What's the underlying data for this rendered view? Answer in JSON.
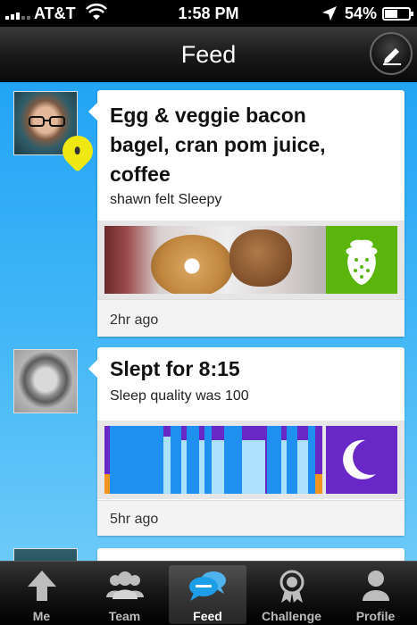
{
  "status_bar": {
    "carrier": "AT&T",
    "time": "1:58 PM",
    "battery": "54%",
    "battery_level": 0.54
  },
  "nav": {
    "title": "Feed",
    "compose_icon": "pencil-icon"
  },
  "feed": {
    "items": [
      {
        "title_lines": [
          "Egg & veggie bacon",
          "bagel, cran pom juice,",
          "coffee"
        ],
        "subtitle": "shawn felt Sleepy",
        "mood": "sleepy-face-icon",
        "category_icon": "strawberry-icon",
        "category_color": "#5ab50d",
        "time_ago": "2hr ago"
      },
      {
        "title_lines": [
          "Slept for 8:15"
        ],
        "subtitle": "Sleep quality was 100",
        "category_icon": "moon-icon",
        "category_color": "#6a27c8",
        "time_ago": "5hr ago"
      }
    ]
  },
  "tabs": [
    {
      "label": "Me",
      "icon": "arrow-up-icon",
      "active": false
    },
    {
      "label": "Team",
      "icon": "team-icon",
      "active": false
    },
    {
      "label": "Feed",
      "icon": "chat-bubbles-icon",
      "active": true
    },
    {
      "label": "Challenge",
      "icon": "medal-icon",
      "active": false
    },
    {
      "label": "Profile",
      "icon": "person-icon",
      "active": false
    }
  ],
  "colors": {
    "feed_background": "#2aa8f5",
    "active_tab_icon": "#1c9ee8"
  }
}
